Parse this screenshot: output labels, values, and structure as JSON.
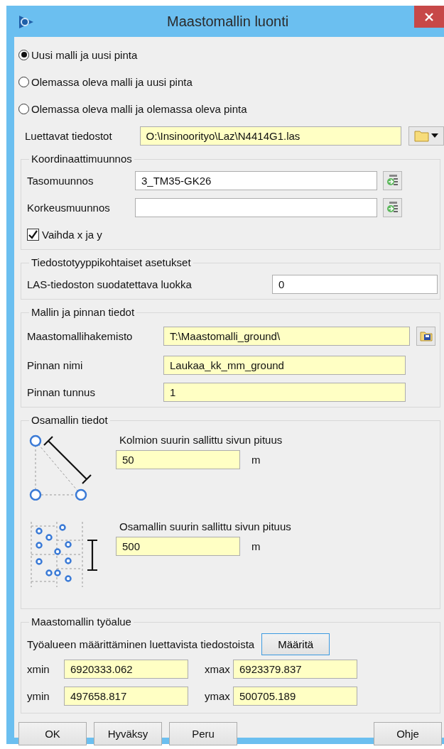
{
  "window": {
    "title": "Maastomallin luonti"
  },
  "mode_options": [
    {
      "label": "Uusi malli ja uusi pinta",
      "selected": true
    },
    {
      "label": "Olemassa oleva malli ja uusi pinta",
      "selected": false
    },
    {
      "label": "Olemassa oleva malli ja olemassa oleva pinta",
      "selected": false
    }
  ],
  "input_files": {
    "label": "Luettavat tiedostot",
    "value": "O:\\Insinoorityo\\Laz\\N4414G1.las",
    "highlighted": true
  },
  "coordinate_transform": {
    "title": "Koordinaattimuunnos",
    "rows": [
      {
        "label": "Tasomuunnos",
        "value": "3_TM35-GK26",
        "highlighted": false
      },
      {
        "label": "Korkeusmuunnos",
        "value": "",
        "highlighted": false
      }
    ],
    "swap_xy": {
      "label": "Vaihda x ja y",
      "checked": true
    }
  },
  "file_type_settings": {
    "title": "Tiedostotyyppikohtaiset asetukset",
    "label": "LAS-tiedoston suodatettava luokka",
    "value": "0",
    "highlighted": false
  },
  "model_surface": {
    "title": "Mallin ja pinnan tiedot",
    "directory": {
      "label": "Maastomallihakemisto",
      "value": "T:\\Maastomalli_ground\\",
      "highlighted": true
    },
    "rows": [
      {
        "label": "Pinnan nimi",
        "value": "Laukaa_kk_mm_ground",
        "highlighted": true
      },
      {
        "label": "Pinnan tunnus",
        "value": "1",
        "highlighted": true
      }
    ]
  },
  "submodel": {
    "title": "Osamallin tiedot",
    "rows": [
      {
        "kind": "triangle",
        "label": "Kolmion suurin sallittu sivun pituus",
        "value": "50",
        "unit": "m",
        "highlighted": true
      },
      {
        "kind": "grid",
        "label": "Osamallin suurin sallittu sivun pituus",
        "value": "500",
        "unit": "m",
        "highlighted": true
      }
    ]
  },
  "work_area": {
    "title": "Maastomallin työalue",
    "define_label": "Työalueen määrittäminen luettavista tiedostoista",
    "define_button": "Määritä",
    "fields": [
      {
        "label": "xmin",
        "value": "6920333.062",
        "highlighted": true
      },
      {
        "label": "xmax",
        "value": "6923379.837",
        "highlighted": true
      },
      {
        "label": "ymin",
        "value": "497658.817",
        "highlighted": true
      },
      {
        "label": "ymax",
        "value": "500705.189",
        "highlighted": true
      }
    ]
  },
  "buttons": [
    {
      "label": "OK"
    },
    {
      "label": "Hyväksy"
    },
    {
      "label": "Peru"
    },
    {
      "label": "Ohje"
    }
  ]
}
